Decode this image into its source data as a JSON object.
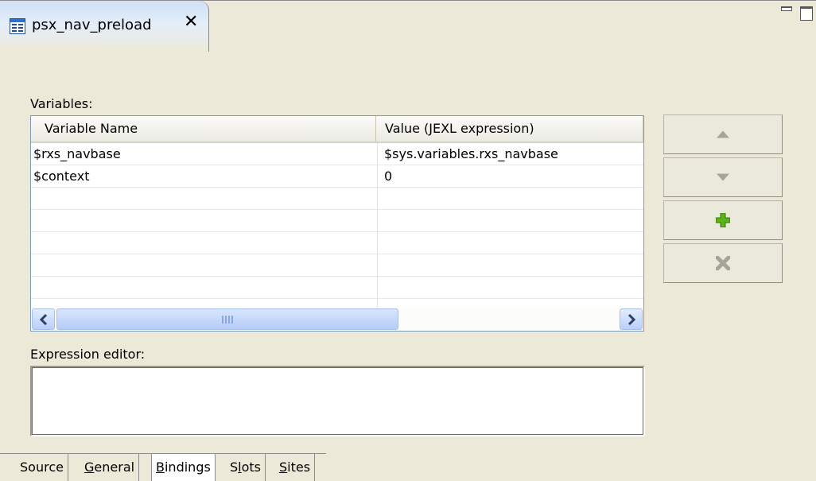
{
  "editor_tab": {
    "title": "psx_nav_preload",
    "icon": "editor-form-icon",
    "close_icon": "close-x-icon"
  },
  "window_controls": [
    "minimize-icon",
    "maximize-icon"
  ],
  "variables": {
    "label": "Variables:",
    "columns": [
      "Variable Name",
      "Value (JEXL expression)"
    ],
    "rows": [
      {
        "name": "$rxs_navbase",
        "value": "$sys.variables.rxs_navbase"
      },
      {
        "name": "$context",
        "value": "0"
      },
      {
        "name": "",
        "value": ""
      },
      {
        "name": "",
        "value": ""
      },
      {
        "name": "",
        "value": ""
      },
      {
        "name": "",
        "value": ""
      },
      {
        "name": "",
        "value": ""
      }
    ],
    "scrollbar": {
      "left_icon": "chevron-left-icon",
      "right_icon": "chevron-right-icon",
      "grip": "III"
    }
  },
  "side_buttons": [
    {
      "icon": "move-up-triangle-icon",
      "enabled": false
    },
    {
      "icon": "move-down-triangle-icon",
      "enabled": false
    },
    {
      "icon": "add-plus-icon",
      "enabled": true
    },
    {
      "icon": "delete-x-icon",
      "enabled": false
    }
  ],
  "expression_editor": {
    "label": "Expression editor:",
    "value": ""
  },
  "bottom_tabs": [
    {
      "label": "Source",
      "mnemonic": "",
      "active": false
    },
    {
      "label": "General",
      "mnemonic": "G",
      "active": false
    },
    {
      "label": "Bindings",
      "mnemonic": "B",
      "active": true
    },
    {
      "label": "Slots",
      "mnemonic": "l",
      "active": false
    },
    {
      "label": "Sites",
      "mnemonic": "S",
      "active": false
    }
  ],
  "colors": {
    "background": "#ece9d8",
    "tab_highlight": "#cfe0f6",
    "scrollbar_blue": "#b9d0fa",
    "add_icon_green": "#5cb319",
    "disabled_icon_gray": "#a6a498"
  }
}
